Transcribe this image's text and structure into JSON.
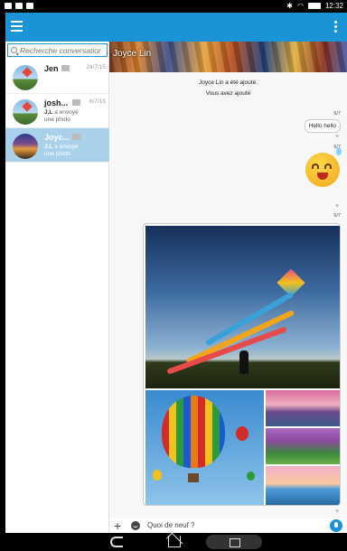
{
  "status": {
    "time": "12:32"
  },
  "search": {
    "placeholder": "Recherche conversation"
  },
  "conversations": [
    {
      "name": "Jen",
      "date": "24/7/15",
      "line1": "",
      "line2": "",
      "line3": ""
    },
    {
      "name": "josh...",
      "date": "6/7/15",
      "line1": "J.L",
      "line2": " a envoyé",
      "line3": "une photo"
    },
    {
      "name": "Joyc...",
      "date": "",
      "line1": "J.L",
      "line2": " a envoyé",
      "line3": "une photo"
    }
  ],
  "chat": {
    "title": "Joyce Lin",
    "system": [
      "Joyce Lin a été ajouté.",
      "Vous avez ajouté"
    ],
    "messages": [
      {
        "time": "6/7",
        "text": "Hello hello"
      },
      {
        "time": "6/7",
        "type": "sticker"
      },
      {
        "time": "6/7",
        "type": "photo"
      }
    ]
  },
  "composer": {
    "placeholder": "Quoi de neuf ?"
  },
  "colors": {
    "accent": "#1a94d6",
    "selected": "#a9d2ea"
  }
}
